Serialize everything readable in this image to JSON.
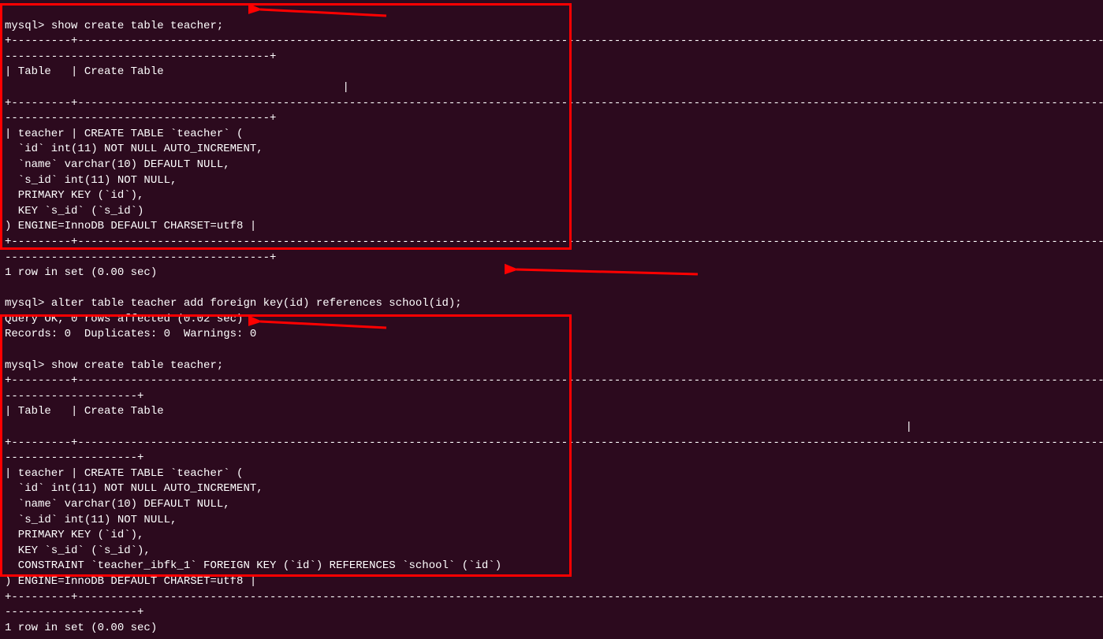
{
  "block1": {
    "prompt": "mysql> ",
    "command": "show create table teacher;",
    "sep1": "+---------+-------------------------------------------------------------------------------------------------------------------------------------------------------------------------------------------------------------+",
    "header1": "| Table   | Create Table",
    "header2": "                                                   |",
    "sep2": "+---------+-------------------------------------------------------------------------------------------------------------------------------------------------------------------------------------------------------------+",
    "body1": "| teacher | CREATE TABLE `teacher` (",
    "body2": "  `id` int(11) NOT NULL AUTO_INCREMENT,",
    "body3": "  `name` varchar(10) DEFAULT NULL,",
    "body4": "  `s_id` int(11) NOT NULL,",
    "body5": "  PRIMARY KEY (`id`),",
    "body6": "  KEY `s_id` (`s_id`)",
    "body7": ") ENGINE=InnoDB DEFAULT CHARSET=utf8 |",
    "sep3": "+---------+-------------------------------------------------------------------------------------------------------------------------------------------------------------------------------------------------------------+",
    "footer": "1 row in set (0.00 sec)"
  },
  "block2": {
    "prompt": "mysql> ",
    "command": "alter table teacher add foreign key(id) references school(id);",
    "result1": "Query OK, 0 rows affected (0.02 sec)",
    "result2": "Records: 0  Duplicates: 0  Warnings: 0"
  },
  "block3": {
    "prompt": "mysql> ",
    "command": "show create table teacher;",
    "sep1": "+---------+-----------------------------------------------------------------------------------------------------------------------------------------------------------------------------------------------------------------------------------------------------------------------------+",
    "header1": "| Table   | Create Table",
    "header2": "                                                                                                                                        |",
    "sep2": "+---------+-----------------------------------------------------------------------------------------------------------------------------------------------------------------------------------------------------------------------------------------------------------------------------+",
    "body1": "| teacher | CREATE TABLE `teacher` (",
    "body2": "  `id` int(11) NOT NULL AUTO_INCREMENT,",
    "body3": "  `name` varchar(10) DEFAULT NULL,",
    "body4": "  `s_id` int(11) NOT NULL,",
    "body5": "  PRIMARY KEY (`id`),",
    "body6": "  KEY `s_id` (`s_id`),",
    "body7": "  CONSTRAINT `teacher_ibfk_1` FOREIGN KEY (`id`) REFERENCES `school` (`id`)",
    "body8": ") ENGINE=InnoDB DEFAULT CHARSET=utf8 |",
    "sep3": "+---------+-----------------------------------------------------------------------------------------------------------------------------------------------------------------------------------------------------------------------------------------------------------------------------+",
    "footer": "1 row in set (0.00 sec)"
  }
}
